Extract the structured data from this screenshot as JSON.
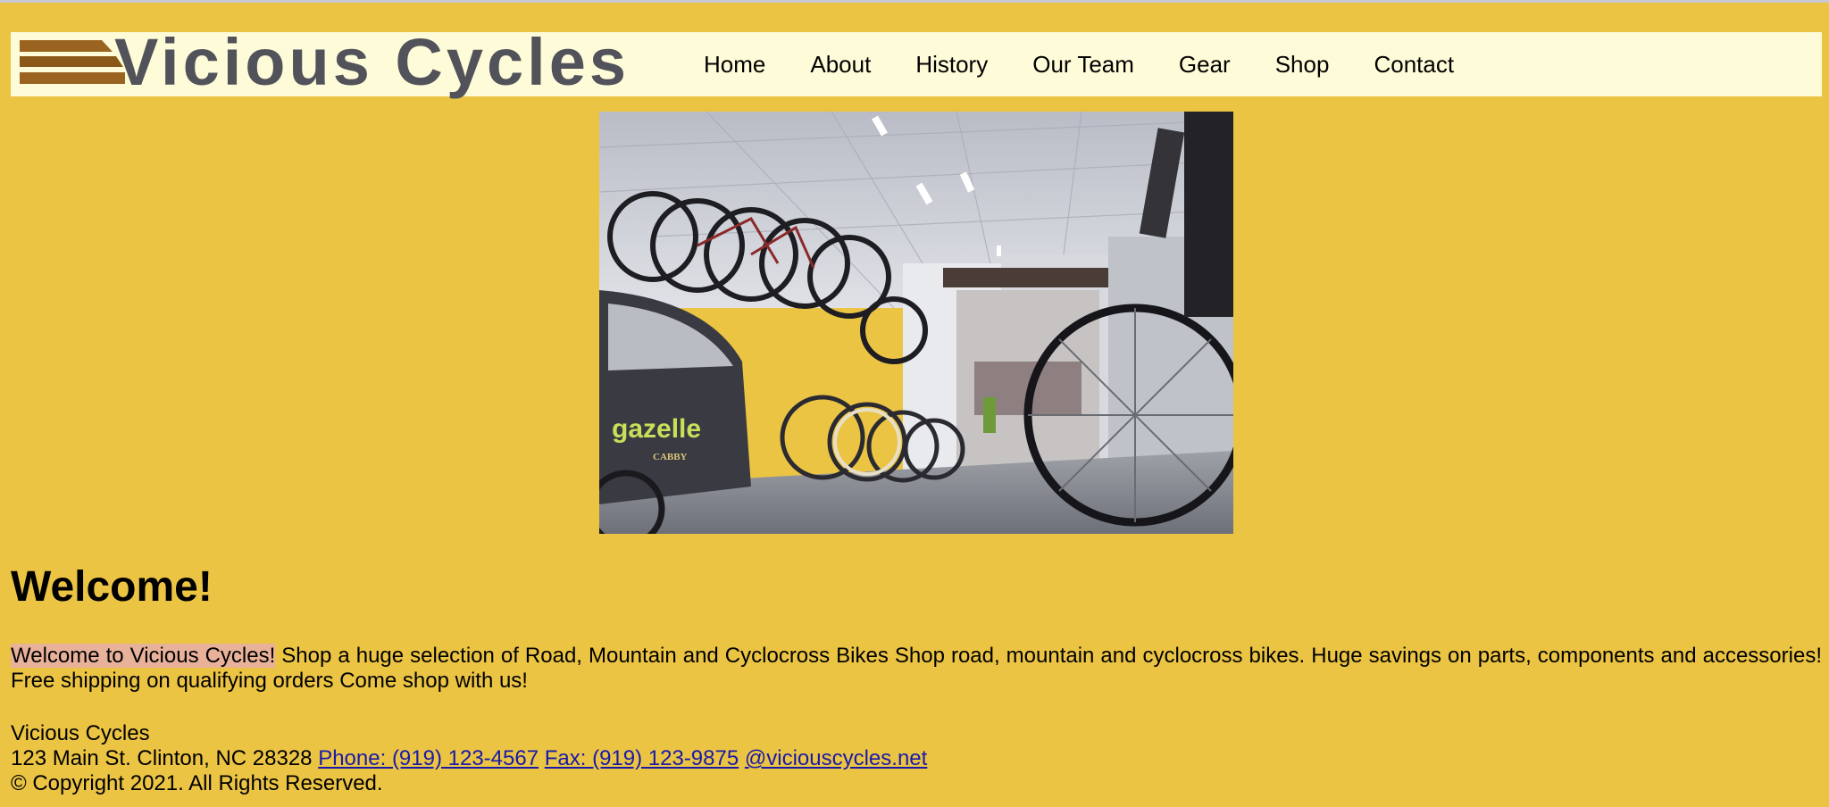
{
  "brand": {
    "name": "Vicious Cycles",
    "colors": {
      "stripe": "#9a6420",
      "text": "#51525a"
    }
  },
  "nav": {
    "items": [
      {
        "label": "Home"
      },
      {
        "label": "About"
      },
      {
        "label": "History"
      },
      {
        "label": "Our Team"
      },
      {
        "label": "Gear"
      },
      {
        "label": "Shop"
      },
      {
        "label": "Contact"
      }
    ]
  },
  "hero": {
    "image_icon": "bike-shop-photo-icon",
    "trailer_text": "gazelle",
    "trailer_subtext": "CABBY"
  },
  "main": {
    "heading": "Welcome!",
    "intro_highlight": "Welcome to Vicious Cycles!",
    "intro_rest": " Shop a huge selection of Road, Mountain and Cyclocross Bikes Shop road, mountain and cyclocross bikes. Huge savings on parts, components and accessories! Free shipping on qualifying orders Come shop with us!"
  },
  "footer": {
    "company": "Vicious Cycles",
    "address": "123 Main St. Clinton, NC 28328",
    "phone": "Phone: (919) 123-4567",
    "fax": "Fax: (919) 123-9875",
    "email": "@viciouscycles.net",
    "copyright": "© Copyright 2021. All Rights Reserved."
  },
  "colors": {
    "page_bg": "#ebc444",
    "header_bg": "#fefbd8",
    "highlight": "#e8b19a",
    "link": "#1a1aa8"
  }
}
